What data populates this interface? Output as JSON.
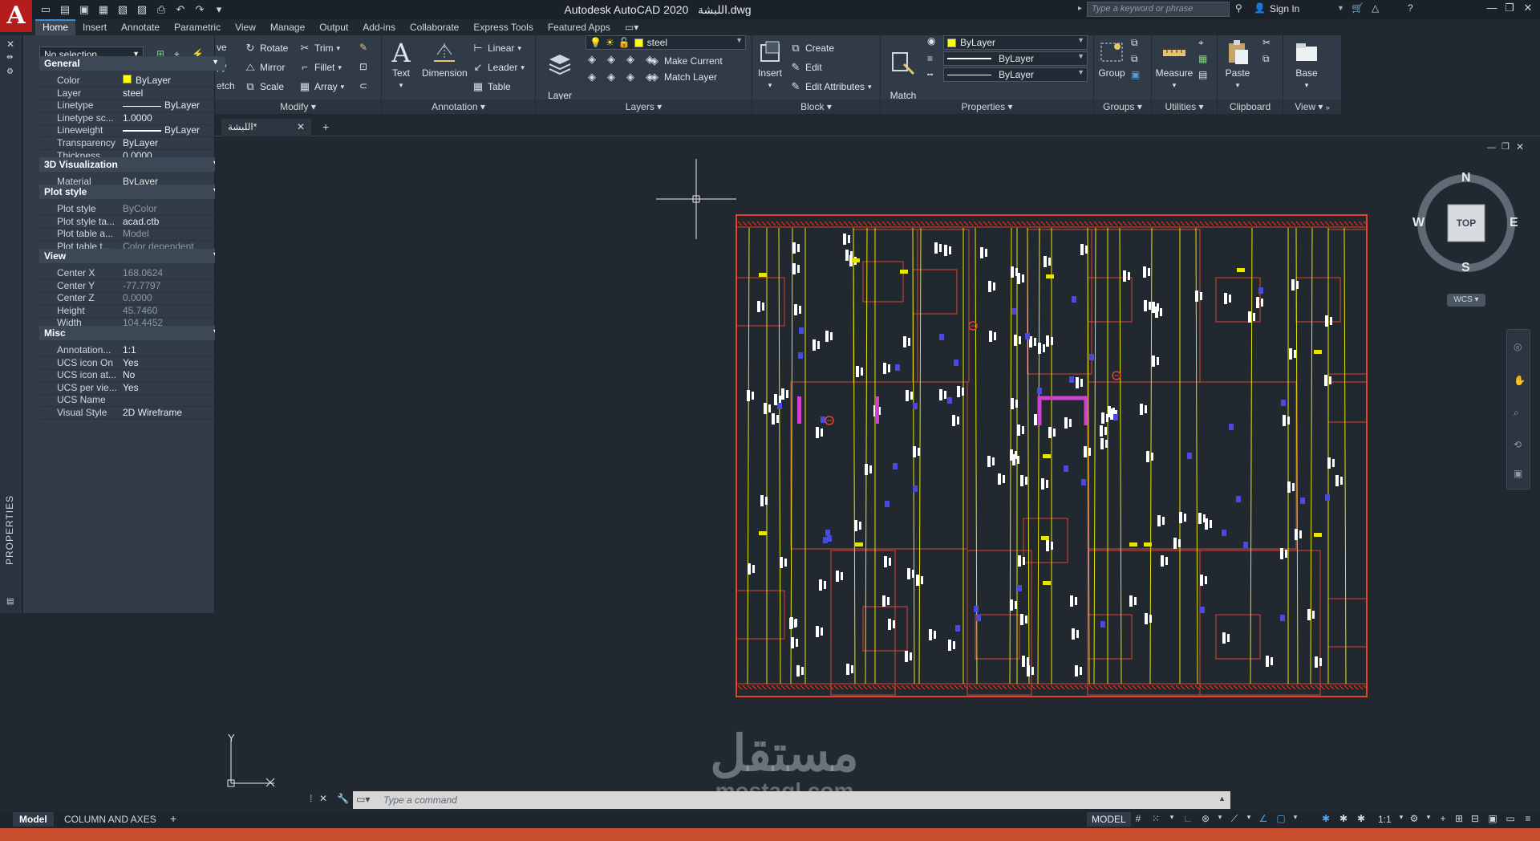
{
  "title": {
    "app": "Autodesk AutoCAD 2020",
    "file": "اللبشة.dwg"
  },
  "search": {
    "placeholder": "Type a keyword or phrase"
  },
  "account": {
    "signin": "Sign In"
  },
  "ribbon_tabs": [
    "Home",
    "Insert",
    "Annotate",
    "Parametric",
    "View",
    "Manage",
    "Output",
    "Add-ins",
    "Collaborate",
    "Express Tools",
    "Featured Apps"
  ],
  "ribbon": {
    "modify": {
      "title": "Modify",
      "partial": [
        "ve",
        "py",
        "etch"
      ],
      "rotate": "Rotate",
      "trim": "Trim",
      "mirror": "Mirror",
      "fillet": "Fillet",
      "scale": "Scale",
      "array": "Array"
    },
    "annotation": {
      "title": "Annotation",
      "text": "Text",
      "dimension": "Dimension",
      "linear": "Linear",
      "leader": "Leader",
      "table": "Table"
    },
    "layers": {
      "title": "Layers",
      "layer_properties": "Layer\nProperties",
      "current_layer": "steel",
      "make_current": "Make Current",
      "match_layer": "Match Layer"
    },
    "block": {
      "title": "Block",
      "insert": "Insert",
      "create": "Create",
      "edit": "Edit",
      "edit_attributes": "Edit Attributes"
    },
    "properties": {
      "title": "Properties",
      "match_properties": "Match\nProperties",
      "color": "ByLayer",
      "lineweight": "ByLayer",
      "linetype": "ByLayer"
    },
    "groups": {
      "title": "Groups",
      "group": "Group"
    },
    "utilities": {
      "title": "Utilities",
      "measure": "Measure"
    },
    "clipboard": {
      "title": "Clipboard",
      "paste": "Paste"
    },
    "view": {
      "title": "View",
      "base": "Base"
    }
  },
  "properties_palette": {
    "strip_label": "PROPERTIES",
    "selection": "No selection",
    "sections": {
      "general": {
        "title": "General",
        "rows": [
          {
            "k": "Color",
            "v": "ByLayer"
          },
          {
            "k": "Layer",
            "v": "steel"
          },
          {
            "k": "Linetype",
            "v": "ByLayer"
          },
          {
            "k": "Linetype sc...",
            "v": "1.0000"
          },
          {
            "k": "Lineweight",
            "v": "ByLayer"
          },
          {
            "k": "Transparency",
            "v": "ByLayer"
          },
          {
            "k": "Thickness",
            "v": "0.0000"
          }
        ]
      },
      "viz3d": {
        "title": "3D Visualization",
        "rows": [
          {
            "k": "Material",
            "v": "ByLayer"
          }
        ]
      },
      "plot": {
        "title": "Plot style",
        "rows": [
          {
            "k": "Plot style",
            "v": "ByColor"
          },
          {
            "k": "Plot style ta...",
            "v": "acad.ctb"
          },
          {
            "k": "Plot table a...",
            "v": "Model"
          },
          {
            "k": "Plot table t...",
            "v": "Color dependent"
          }
        ]
      },
      "view": {
        "title": "View",
        "rows": [
          {
            "k": "Center X",
            "v": "168.0624"
          },
          {
            "k": "Center Y",
            "v": "-77.7797"
          },
          {
            "k": "Center Z",
            "v": "0.0000"
          },
          {
            "k": "Height",
            "v": "45.7460"
          },
          {
            "k": "Width",
            "v": "104.4452"
          }
        ]
      },
      "misc": {
        "title": "Misc",
        "rows": [
          {
            "k": "Annotation...",
            "v": "1:1"
          },
          {
            "k": "UCS icon On",
            "v": "Yes"
          },
          {
            "k": "UCS icon at...",
            "v": "No"
          },
          {
            "k": "UCS per vie...",
            "v": "Yes"
          },
          {
            "k": "UCS Name",
            "v": ""
          },
          {
            "k": "Visual Style",
            "v": "2D Wireframe"
          }
        ]
      }
    }
  },
  "file_tab": {
    "name": "اللبشة*"
  },
  "viewcube": {
    "n": "N",
    "s": "S",
    "e": "E",
    "w": "W",
    "face": "TOP",
    "wcs": "WCS"
  },
  "ucs": {
    "y": "Y"
  },
  "command": {
    "placeholder": "Type a command"
  },
  "watermark": {
    "arabic": "مستقل",
    "latin": "mostaql.com"
  },
  "layout_tabs": [
    "Model",
    "COLUMN AND AXES"
  ],
  "status": {
    "model": "MODEL",
    "scale": "1:1"
  },
  "colors": {
    "accent": "#3b8fd6",
    "outline": "#e0432f",
    "steel": "#e6e600",
    "hatch": "#4a4ae0",
    "magenta": "#d040d0"
  }
}
